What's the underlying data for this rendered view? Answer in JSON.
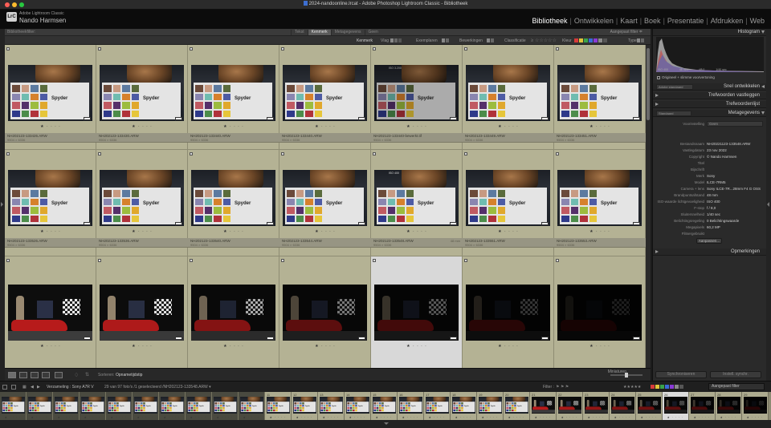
{
  "window": {
    "title": "2024-nandoonline.lrcat - Adobe Photoshop Lightroom Classic - Bibliotheek"
  },
  "identity": {
    "badge": "LrC",
    "subtitle": "Adobe Lightroom Classic",
    "name": "Nando Harmsen"
  },
  "modules": [
    "Bibliotheek",
    "Ontwikkelen",
    "Kaart",
    "Boek",
    "Presentatie",
    "Afdrukken",
    "Web"
  ],
  "active_module": "Bibliotheek",
  "library_filter": {
    "label": "Bibliotheekfilter:",
    "tabs": [
      "Tekst",
      "Kenmerk",
      "Metagegevens",
      "Geen"
    ],
    "active_tab": "Kenmerk",
    "preset": "Aangepast filter ≑"
  },
  "attribute_bar": {
    "kenmerk": "Kenmerk",
    "vlag": "Vlag",
    "exemplaren": "Exemplaren",
    "bewerkingen": "Bewerkingen",
    "classificatie": "Classificatie",
    "kleur": "Kleur",
    "type": "Type",
    "color_chips": [
      "#d63a3a",
      "#e0c43a",
      "#3aa34a",
      "#3a6ad6",
      "#8a3ad6",
      "#8a8a8a",
      "#555555"
    ]
  },
  "grid": {
    "rows": [
      {
        "kind": "chart",
        "cells": [
          {
            "name": "NH202123-133426.ARW",
            "dims": "9504 × 6336",
            "ext": "",
            "overlay": ""
          },
          {
            "name": "NH202123-133430.ARW",
            "dims": "9504 × 6336",
            "ext": "",
            "overlay": ""
          },
          {
            "name": "NH202123-133440.ARW",
            "dims": "9504 × 6336",
            "ext": "",
            "overlay": ""
          },
          {
            "name": "NH202123-133440.ARW",
            "dims": "9504 × 6336",
            "ext": "",
            "overlay": ""
          },
          {
            "name": "NH202123-133440-bewerkt.tif",
            "dims": "9504 × 6336",
            "ext": "",
            "overlay": "ISO 3.200"
          },
          {
            "name": "NH202123-133449.ARW",
            "dims": "9504 × 6336",
            "ext": "",
            "overlay": ""
          },
          {
            "name": "NH202123-133451.ARW",
            "dims": "9504 × 6336",
            "ext": "",
            "overlay": ""
          }
        ]
      },
      {
        "kind": "chart",
        "cells": [
          {
            "name": "NH202123-133526.ARW",
            "dims": "9504 × 6336",
            "ext": "",
            "overlay": ""
          },
          {
            "name": "NH202123-133536.ARW",
            "dims": "9504 × 6336",
            "ext": "",
            "overlay": ""
          },
          {
            "name": "NH202123-133540.ARW",
            "dims": "9504 × 6336",
            "ext": "",
            "overlay": ""
          },
          {
            "name": "NH202123-133544.ARW",
            "dims": "9504 × 6336",
            "ext": "",
            "overlay": ""
          },
          {
            "name": "NH202123-133548.ARW",
            "dims": "9504 × 6336",
            "ext": "48 mm",
            "overlay": "ISO 400"
          },
          {
            "name": "NH202123-133551.ARW",
            "dims": "9504 × 6336",
            "ext": "",
            "overlay": ""
          },
          {
            "name": "NH202123-133553.ARW",
            "dims": "9504 × 6336",
            "ext": "",
            "overlay": ""
          }
        ]
      },
      {
        "kind": "car",
        "cells": [
          {
            "name": "",
            "dims": "",
            "ext": "",
            "overlay": ""
          },
          {
            "name": "",
            "dims": "",
            "ext": "",
            "overlay": ""
          },
          {
            "name": "",
            "dims": "",
            "ext": "",
            "overlay": ""
          },
          {
            "name": "",
            "dims": "",
            "ext": "",
            "overlay": ""
          },
          {
            "name": "",
            "dims": "",
            "ext": "",
            "overlay": ""
          },
          {
            "name": "",
            "dims": "",
            "ext": "",
            "overlay": ""
          },
          {
            "name": "",
            "dims": "",
            "ext": "",
            "overlay": ""
          }
        ]
      }
    ],
    "selected_cell": [
      2,
      4
    ],
    "brightness": [
      1,
      0.95,
      0.72,
      0.5,
      0.36,
      0.22,
      0.12
    ],
    "rating_text": "★ · · · ·"
  },
  "toolbar": {
    "sort_label": "Sorteren:",
    "sort_value": "Opnametijdstip",
    "thumbs_label": "Miniaturen"
  },
  "right_panel": {
    "histogram_title": "Histogram",
    "histogram_meta": [
      "ISO 400",
      "48 mm",
      "f/8,0",
      "1/40 sec"
    ],
    "smart_preview": "Origineel + slimme voorvertoning",
    "quick_develop": "Snel ontwikkelen",
    "quick_preset": "Adobe standaard",
    "keywording": "Trefwoorden vastleggen",
    "keyword_list": "Trefwoordenlijst",
    "metadata": "Metagegevens",
    "metadata_preset": "Standaard",
    "metadata_preset_label": "Voorinstelling",
    "metadata_preset_value": "Geen",
    "fields": [
      {
        "k": "Bestandsnaam",
        "v": "NH20221123-133548.ARW"
      },
      {
        "k": "Vastlegdatum",
        "v": "23 nov 2022"
      },
      {
        "k": "Copyright",
        "v": "© Nando Harmsen"
      },
      {
        "k": "Titel",
        "v": ""
      },
      {
        "k": "Bijschrift",
        "v": ""
      },
      {
        "k": "Merk",
        "v": "Sony"
      },
      {
        "k": "Model",
        "v": "ILCE-7RM5"
      },
      {
        "k": "Camera + lens",
        "v": "Sony ILCE-7R...28mm F4 G OSS"
      },
      {
        "k": "Brandpuntsafstand",
        "v": "48 mm"
      },
      {
        "k": "ISO-waarde lichtgevoeligheid",
        "v": "ISO 400"
      },
      {
        "k": "F-stop",
        "v": "f / 8,0"
      },
      {
        "k": "Sluitersnelheid",
        "v": "1/40 sec"
      },
      {
        "k": "Belichtingsregeling",
        "v": "0 Belichtingswaarde"
      },
      {
        "k": "Megapixels",
        "v": "60,2 MP"
      },
      {
        "k": "Flitsergebruikt",
        "v": ""
      }
    ],
    "customize_button": "Aanpassen...",
    "comments": "Opmerkingen",
    "sync_meta": "Synchroniseren",
    "sync_settings": "Instell. synchr."
  },
  "filmstrip": {
    "source": "Verzameling : Sony A7R V",
    "count": "29 van 97 foto's /1 geselecteerd /NH202123-133548.ARW ▾",
    "filter_label": "Filter :",
    "filter_value": "Aangepast filter",
    "numbers": [
      "",
      "",
      "",
      "",
      "",
      "",
      "",
      "",
      "",
      "",
      "11",
      "12",
      "13",
      "14",
      "15",
      "16",
      "17",
      "18",
      "19",
      "20",
      "21",
      "22",
      "23",
      "24",
      "25",
      "26",
      "27",
      "28",
      "29"
    ],
    "selected_index": 25
  }
}
